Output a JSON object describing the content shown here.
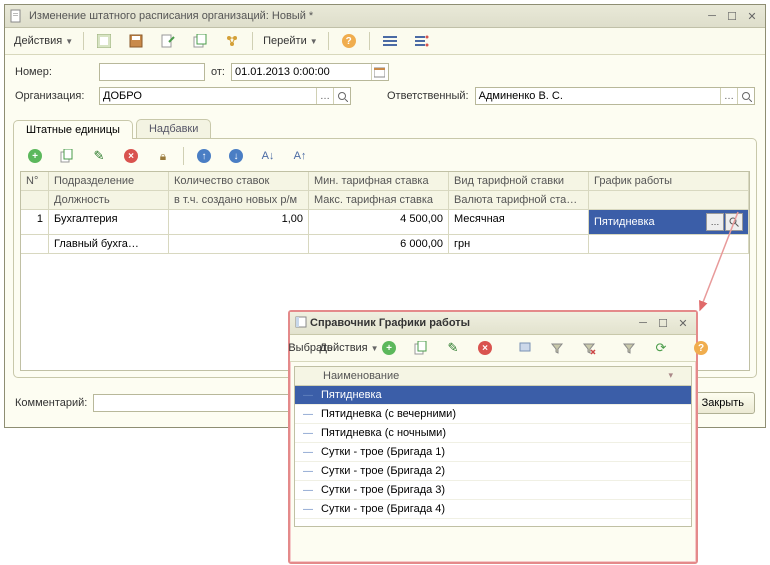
{
  "main_window": {
    "title": "Изменение штатного расписания организаций: Новый *",
    "toolbar": {
      "actions": "Действия",
      "go": "Перейти"
    },
    "form": {
      "number_label": "Номер:",
      "number_value": "",
      "from_label": "от:",
      "date_value": "01.01.2013 0:00:00",
      "org_label": "Организация:",
      "org_value": "ДОБРО",
      "resp_label": "Ответственный:",
      "resp_value": "Админенко В. С."
    },
    "tabs": {
      "tab1": "Штатные единицы",
      "tab2": "Надбавки"
    },
    "grid": {
      "headers": {
        "num": "N°",
        "dept": "Подразделение",
        "position": "Должность",
        "rates": "Количество ставок",
        "created": "в т.ч. создано новых р/м",
        "min_rate": "Мин. тарифная ставка",
        "max_rate": "Макс. тарифная ставка",
        "rate_type": "Вид тарифной ставки",
        "currency": "Валюта тарифной ставки",
        "schedule": "График работы"
      },
      "row1": {
        "n": "1",
        "dept": "Бухгалтерия",
        "position": "Главный бухга…",
        "rates": "1,00",
        "min": "4 500,00",
        "max": "6 000,00",
        "type": "Месячная",
        "currency": "грн",
        "schedule": "Пятидневка"
      }
    },
    "comment_label": "Комментарий:",
    "close_btn": "Закрыть"
  },
  "dialog": {
    "title": "Справочник Графики работы",
    "select_btn": "Выбрать",
    "actions": "Действия",
    "col": "Наименование",
    "items": [
      "Пятидневка",
      "Пятидневка (с вечерними)",
      "Пятидневка (с ночными)",
      "Сутки - трое  (Бригада 1)",
      "Сутки - трое  (Бригада 2)",
      "Сутки - трое  (Бригада 3)",
      "Сутки - трое  (Бригада 4)"
    ]
  }
}
